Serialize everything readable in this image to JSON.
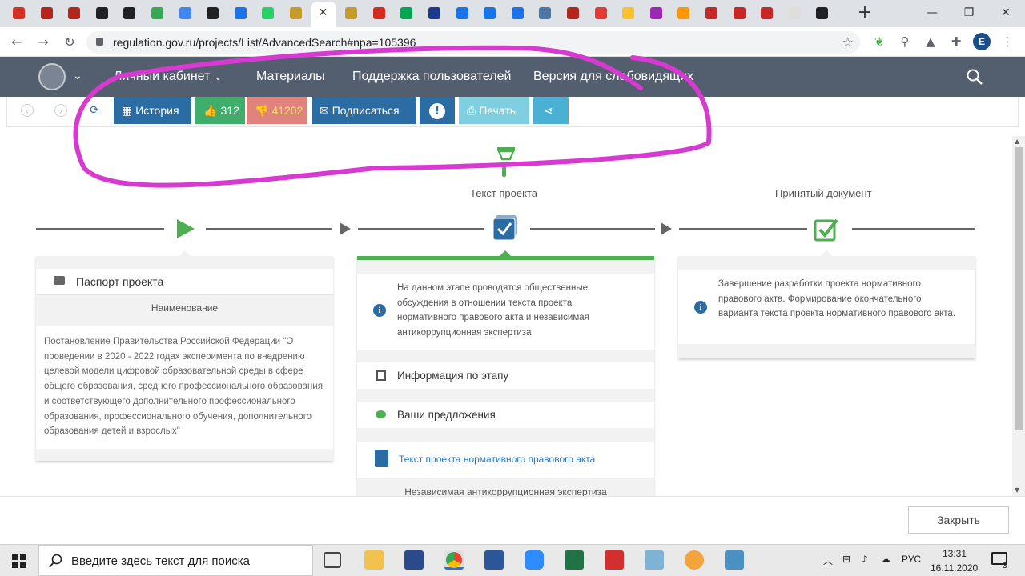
{
  "browser": {
    "url": "regulation.gov.ru/projects/List/AdvancedSearch#npa=105396",
    "active_tab_close": "✕",
    "new_tab": "+",
    "profile_initial": "E",
    "tab_icon_colors": [
      "#d93025",
      "#b3261e",
      "#b3261e",
      "#202124",
      "#202124",
      "#34a853",
      "#4285f4",
      "#222",
      "#1a73e8",
      "#25d366",
      "#c79a2c",
      "#fff",
      "#c79a2c",
      "#d52b1e",
      "#00a651",
      "#1e3a8a",
      "#1a73e8",
      "#1a73e8",
      "#1a73e8",
      "#4a76a8",
      "#b3261e",
      "#e53935",
      "#fbc02d",
      "#9c27b0",
      "#ff9800",
      "#c62828",
      "#c62828",
      "#c62828",
      "#ddd",
      "#202124"
    ]
  },
  "site_nav": {
    "items": [
      "Личный кабинет",
      "Материалы",
      "Поддержка пользователей",
      "Версия для слабовидящих"
    ]
  },
  "toolbar": {
    "history": "История",
    "likes": "312",
    "dislikes": "41202",
    "subscribe": "Подписаться",
    "print": "Печать"
  },
  "stages": {
    "text_label": "Текст проекта",
    "adopted_label": "Принятый документ"
  },
  "passport": {
    "title": "Паспорт проекта",
    "name_header": "Наименование",
    "name_text": "Постановление Правительства Российской Федерации \"О проведении в 2020 - 2022 годах эксперимента по внедрению целевой модели цифровой образовательной среды в сфере общего образования, среднего профессионального образования и соответствующего дополнительного профессионального образования, профессионального обучения, дополнительного образования детей и взрослых\""
  },
  "current_stage": {
    "info": "На данном этапе проводятся общественные обсуждения в отношении текста проекта нормативного правового акта и независимая антикоррупционная экспертиза",
    "stage_info": "Информация по этапу",
    "proposals": "Ваши предложения",
    "doc_link": "Текст проекта нормативного правового акта",
    "expertise": "Независимая антикоррупционная экспертиза"
  },
  "adopted": {
    "info": "Завершение разработки проекта нормативного правового акта. Формирование окончательного варианта текста проекта нормативного правового акта."
  },
  "footer": {
    "close": "Закрыть"
  },
  "taskbar": {
    "search_placeholder": "Введите здесь текст для поиска",
    "lang": "РУС",
    "time": "13:31",
    "date": "16.11.2020",
    "notifications": "3"
  },
  "colors": {
    "nav_bg": "#535e6e",
    "history_btn": "#2b6ca3",
    "like_btn": "#3fae6a",
    "dislike_btn": "#e0827d",
    "dislike_text": "#f2e36b",
    "subscribe_btn": "#2b6ca3",
    "alert_btn": "#2b6ca3",
    "print_btn": "#7fcfe0",
    "share_btn": "#4ab0d4",
    "green": "#4caf50",
    "link_blue": "#2b78c2",
    "marker": "#d63ad0"
  }
}
